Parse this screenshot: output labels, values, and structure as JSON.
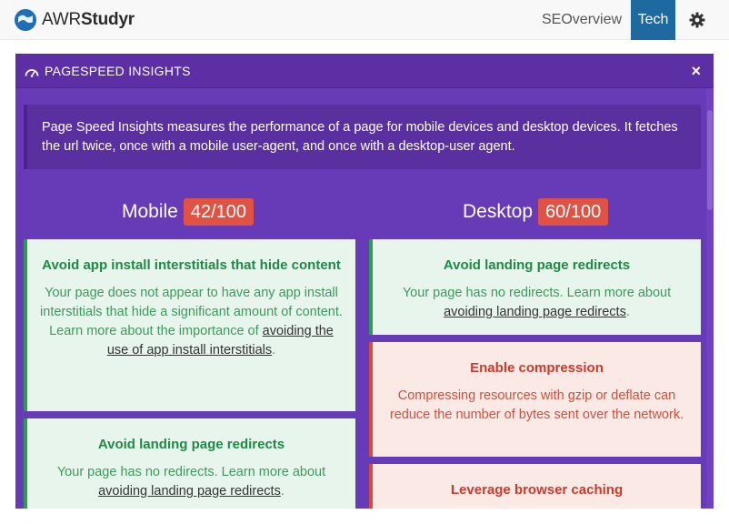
{
  "nav": {
    "brand_prefix": "AWR",
    "brand_suffix": "Studyr",
    "links": [
      "SEOverview",
      "Tech"
    ],
    "active": "Tech",
    "settings_icon": "gear-icon"
  },
  "modal": {
    "title": "PAGESPEED INSIGHTS",
    "title_icon": "speedometer-icon",
    "close_label": "×",
    "intro": "Page Speed Insights measures the performance of a page for mobile devices and desktop devices. It fetches the url twice, once with a mobile user-agent, and once with a desktop-user agent.",
    "mobile": {
      "label": "Mobile",
      "score": "42/100",
      "cards": [
        {
          "status": "pass",
          "title": "Avoid app install interstitials that hide content",
          "text": "Your page does not appear to have any app install interstitials that hide a significant amount of content. Learn more about the importance of ",
          "link": "avoiding the use of app install interstitials",
          "after": "."
        },
        {
          "status": "pass",
          "title": "Avoid landing page redirects",
          "text": "Your page has no redirects. Learn more about ",
          "link": "avoiding landing page redirects",
          "after": "."
        }
      ]
    },
    "desktop": {
      "label": "Desktop",
      "score": "60/100",
      "cards": [
        {
          "status": "pass",
          "title": "Avoid landing page redirects",
          "text": "Your page has no redirects. Learn more about ",
          "link": "avoiding landing page redirects",
          "after": "."
        },
        {
          "status": "fail",
          "title": "Enable compression",
          "text": "Compressing resources with gzip or deflate can reduce the number of bytes sent over the network."
        },
        {
          "status": "fail",
          "title": "Leverage browser caching"
        }
      ]
    }
  },
  "colors": {
    "modal_bg": "#673ab7",
    "pass_green": "#1e8a45",
    "fail_red": "#cc3a2c",
    "score_badge": "#e05244",
    "nav_active": "#1e6aa0"
  }
}
